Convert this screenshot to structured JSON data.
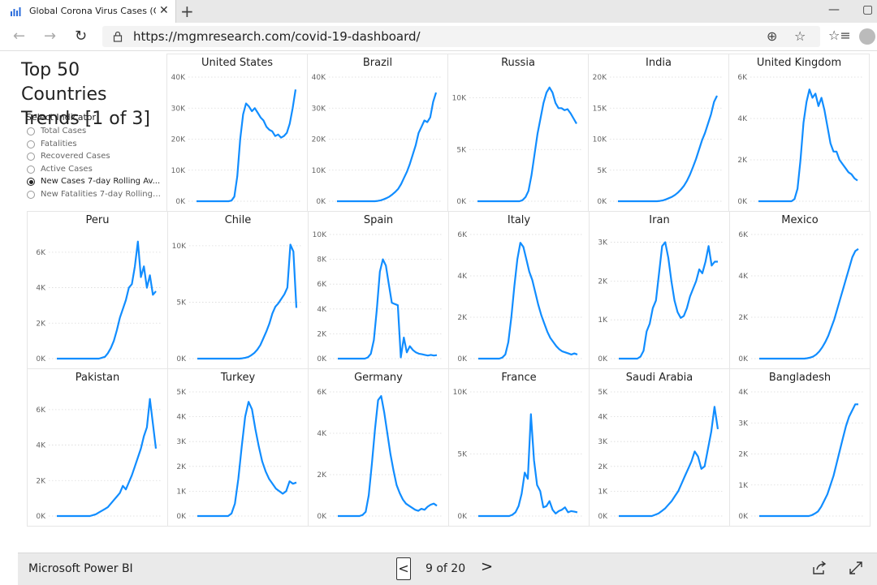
{
  "browser": {
    "tab_title": "Global Corona Virus Cases (Covid",
    "tab_close": "✕",
    "new_tab": "+",
    "url": "https://mgmresearch.com/covid-19-dashboard/",
    "nav_back_icon": "←",
    "nav_forward_icon": "→",
    "refresh_icon": "↻",
    "zoom_icon": "⊕",
    "favorite_icon": "☆",
    "favorites_bar_icon": "☆≡",
    "minimize_icon": "—",
    "maximize_icon": "▢"
  },
  "report": {
    "title": "Top 50 Countries Trends [1 of 3]",
    "slicer": {
      "title": "Select Indicator",
      "items": [
        {
          "label": "Total Cases",
          "selected": false
        },
        {
          "label": "Fatalities",
          "selected": false
        },
        {
          "label": "Recovered Cases",
          "selected": false
        },
        {
          "label": "Active Cases",
          "selected": false
        },
        {
          "label": "New Cases 7-day Rolling Av...",
          "selected": true
        },
        {
          "label": "New Fatalities 7-day Rolling ...",
          "selected": false
        }
      ]
    },
    "accent_color": "#118DFF"
  },
  "footer": {
    "brand": "Microsoft Power BI",
    "prev": "<",
    "page_text": "9 of 20",
    "next": ">"
  },
  "chart_data": [
    {
      "type": "line",
      "title": "United States",
      "ylim": [
        0,
        40000
      ],
      "yticks": [
        0,
        10000,
        20000,
        30000,
        40000
      ],
      "ytick_labels": [
        "0K",
        "10K",
        "20K",
        "30K",
        "40K"
      ],
      "values": [
        0,
        0,
        0,
        0,
        0,
        0,
        0,
        0,
        0,
        0,
        0,
        0,
        200,
        1500,
        8000,
        20000,
        28000,
        31500,
        30500,
        29000,
        30000,
        28500,
        27000,
        26000,
        24000,
        23000,
        22500,
        21000,
        21500,
        20500,
        21000,
        22000,
        25000,
        30000,
        36000
      ]
    },
    {
      "type": "line",
      "title": "Brazil",
      "ylim": [
        0,
        40000
      ],
      "yticks": [
        0,
        10000,
        20000,
        30000,
        40000
      ],
      "ytick_labels": [
        "0K",
        "10K",
        "20K",
        "30K",
        "40K"
      ],
      "values": [
        0,
        0,
        0,
        0,
        0,
        0,
        0,
        0,
        0,
        0,
        0,
        0,
        0,
        0,
        100,
        300,
        600,
        1000,
        1500,
        2200,
        3000,
        4000,
        5500,
        7500,
        9500,
        12000,
        15000,
        18000,
        22000,
        24000,
        26000,
        25500,
        27000,
        32000,
        35000
      ]
    },
    {
      "type": "line",
      "title": "Russia",
      "ylim": [
        0,
        12000
      ],
      "yticks": [
        0,
        5000,
        10000
      ],
      "ytick_labels": [
        "0K",
        "5K",
        "10K"
      ],
      "values": [
        0,
        0,
        0,
        0,
        0,
        0,
        0,
        0,
        0,
        0,
        0,
        0,
        0,
        0,
        0,
        100,
        400,
        1000,
        2500,
        4500,
        6500,
        8000,
        9500,
        10500,
        11000,
        10500,
        9500,
        9000,
        9000,
        8800,
        8900,
        8500,
        8000,
        7500
      ]
    },
    {
      "type": "line",
      "title": "India",
      "ylim": [
        0,
        20000
      ],
      "yticks": [
        0,
        5000,
        10000,
        15000,
        20000
      ],
      "ytick_labels": [
        "0K",
        "5K",
        "10K",
        "15K",
        "20K"
      ],
      "values": [
        0,
        0,
        0,
        0,
        0,
        0,
        0,
        0,
        0,
        0,
        0,
        0,
        0,
        0,
        50,
        150,
        300,
        500,
        700,
        1000,
        1400,
        1900,
        2500,
        3300,
        4300,
        5500,
        6800,
        8300,
        9800,
        11000,
        12500,
        14000,
        16000,
        17000
      ]
    },
    {
      "type": "line",
      "title": "United Kingdom",
      "ylim": [
        0,
        6000
      ],
      "yticks": [
        0,
        2000,
        4000,
        6000
      ],
      "ytick_labels": [
        "0K",
        "2K",
        "4K",
        "6K"
      ],
      "values": [
        0,
        0,
        0,
        0,
        0,
        0,
        0,
        0,
        0,
        0,
        0,
        0,
        100,
        600,
        2000,
        3800,
        4800,
        5400,
        5000,
        5200,
        4600,
        5000,
        4400,
        3600,
        2800,
        2400,
        2400,
        2000,
        1800,
        1600,
        1400,
        1300,
        1100,
        1000
      ]
    },
    {
      "type": "line",
      "title": "Peru",
      "ylim": [
        0,
        7000
      ],
      "yticks": [
        0,
        2000,
        4000,
        6000
      ],
      "ytick_labels": [
        "0K",
        "2K",
        "4K",
        "6K"
      ],
      "values": [
        0,
        0,
        0,
        0,
        0,
        0,
        0,
        0,
        0,
        0,
        0,
        0,
        0,
        0,
        0,
        50,
        100,
        300,
        600,
        1000,
        1600,
        2300,
        2800,
        3300,
        4000,
        4200,
        5200,
        6600,
        4600,
        5200,
        4000,
        4700,
        3600,
        3800
      ]
    },
    {
      "type": "line",
      "title": "Chile",
      "ylim": [
        0,
        11000
      ],
      "yticks": [
        0,
        5000,
        10000
      ],
      "ytick_labels": [
        "0K",
        "5K",
        "10K"
      ],
      "values": [
        0,
        0,
        0,
        0,
        0,
        0,
        0,
        0,
        0,
        0,
        0,
        0,
        0,
        0,
        0,
        30,
        80,
        150,
        300,
        500,
        800,
        1200,
        1800,
        2400,
        3100,
        4000,
        4600,
        4900,
        5300,
        5700,
        6300,
        10100,
        9500,
        4500
      ]
    },
    {
      "type": "line",
      "title": "Spain",
      "ylim": [
        0,
        10000
      ],
      "yticks": [
        0,
        2000,
        4000,
        6000,
        8000,
        10000
      ],
      "ytick_labels": [
        "0K",
        "2K",
        "4K",
        "6K",
        "8K",
        "10K"
      ],
      "values": [
        0,
        0,
        0,
        0,
        0,
        0,
        0,
        0,
        0,
        0,
        100,
        400,
        1500,
        4000,
        7000,
        8000,
        7500,
        6000,
        4500,
        4400,
        4300,
        100,
        1700,
        500,
        1000,
        700,
        500,
        400,
        350,
        300,
        250,
        300,
        250,
        280
      ]
    },
    {
      "type": "line",
      "title": "Italy",
      "ylim": [
        0,
        6000
      ],
      "yticks": [
        0,
        2000,
        4000,
        6000
      ],
      "ytick_labels": [
        "0K",
        "2K",
        "4K",
        "6K"
      ],
      "values": [
        0,
        0,
        0,
        0,
        0,
        0,
        0,
        0,
        50,
        200,
        800,
        2000,
        3500,
        4800,
        5600,
        5400,
        4800,
        4200,
        3800,
        3200,
        2600,
        2100,
        1700,
        1300,
        1000,
        800,
        600,
        450,
        350,
        300,
        250,
        200,
        250,
        200
      ]
    },
    {
      "type": "line",
      "title": "Iran",
      "ylim": [
        0,
        3200
      ],
      "yticks": [
        0,
        1000,
        2000,
        3000
      ],
      "ytick_labels": [
        "0K",
        "1K",
        "2K",
        "3K"
      ],
      "values": [
        0,
        0,
        0,
        0,
        0,
        0,
        0,
        50,
        200,
        700,
        900,
        1300,
        1500,
        2200,
        2900,
        3000,
        2600,
        2000,
        1500,
        1200,
        1050,
        1100,
        1300,
        1600,
        1800,
        2000,
        2300,
        2200,
        2500,
        2900,
        2400,
        2500,
        2500
      ]
    },
    {
      "type": "line",
      "title": "Mexico",
      "ylim": [
        0,
        6000
      ],
      "yticks": [
        0,
        2000,
        4000,
        6000
      ],
      "ytick_labels": [
        "0K",
        "2K",
        "4K",
        "6K"
      ],
      "values": [
        0,
        0,
        0,
        0,
        0,
        0,
        0,
        0,
        0,
        0,
        0,
        0,
        0,
        0,
        0,
        0,
        20,
        50,
        100,
        200,
        350,
        550,
        800,
        1100,
        1500,
        1900,
        2400,
        2900,
        3400,
        3900,
        4400,
        4900,
        5200,
        5300
      ]
    },
    {
      "type": "line",
      "title": "Pakistan",
      "ylim": [
        0,
        7000
      ],
      "yticks": [
        0,
        2000,
        4000,
        6000
      ],
      "ytick_labels": [
        "0K",
        "2K",
        "4K",
        "6K"
      ],
      "values": [
        0,
        0,
        0,
        0,
        0,
        0,
        0,
        0,
        0,
        0,
        0,
        0,
        50,
        100,
        200,
        300,
        400,
        500,
        700,
        900,
        1100,
        1300,
        1700,
        1500,
        1900,
        2300,
        2800,
        3300,
        3800,
        4500,
        5000,
        6600,
        5200,
        3800
      ]
    },
    {
      "type": "line",
      "title": "Turkey",
      "ylim": [
        0,
        5000
      ],
      "yticks": [
        0,
        1000,
        2000,
        3000,
        4000,
        5000
      ],
      "ytick_labels": [
        "0K",
        "1K",
        "2K",
        "3K",
        "4K",
        "5K"
      ],
      "values": [
        0,
        0,
        0,
        0,
        0,
        0,
        0,
        0,
        0,
        0,
        100,
        500,
        1500,
        2800,
        4000,
        4600,
        4300,
        3500,
        2800,
        2200,
        1800,
        1500,
        1300,
        1100,
        1000,
        900,
        1000,
        1400,
        1300,
        1350
      ]
    },
    {
      "type": "line",
      "title": "Germany",
      "ylim": [
        0,
        6000
      ],
      "yticks": [
        0,
        2000,
        4000,
        6000
      ],
      "ytick_labels": [
        "0K",
        "2K",
        "4K",
        "6K"
      ],
      "values": [
        0,
        0,
        0,
        0,
        0,
        0,
        0,
        0,
        50,
        200,
        1000,
        2500,
        4200,
        5600,
        5800,
        5000,
        4000,
        3000,
        2200,
        1500,
        1100,
        800,
        600,
        500,
        400,
        300,
        250,
        350,
        300,
        450,
        550,
        600,
        500
      ]
    },
    {
      "type": "line",
      "title": "France",
      "ylim": [
        0,
        10000
      ],
      "yticks": [
        0,
        5000,
        10000
      ],
      "ytick_labels": [
        "0K",
        "5K",
        "10K"
      ],
      "values": [
        0,
        0,
        0,
        0,
        0,
        0,
        0,
        0,
        0,
        0,
        0,
        100,
        300,
        800,
        1800,
        3500,
        3000,
        8200,
        4500,
        2500,
        2000,
        700,
        800,
        1200,
        500,
        200,
        400,
        500,
        700,
        300,
        400,
        350,
        300
      ]
    },
    {
      "type": "line",
      "title": "Saudi Arabia",
      "ylim": [
        0,
        5000
      ],
      "yticks": [
        0,
        1000,
        2000,
        3000,
        4000,
        5000
      ],
      "ytick_labels": [
        "0K",
        "1K",
        "2K",
        "3K",
        "4K",
        "5K"
      ],
      "values": [
        0,
        0,
        0,
        0,
        0,
        0,
        0,
        0,
        0,
        0,
        0,
        50,
        100,
        200,
        300,
        450,
        600,
        800,
        1000,
        1300,
        1600,
        1900,
        2200,
        2600,
        2400,
        1900,
        2000,
        2700,
        3400,
        4400,
        3500
      ]
    },
    {
      "type": "line",
      "title": "Bangladesh",
      "ylim": [
        0,
        4000
      ],
      "yticks": [
        0,
        1000,
        2000,
        3000,
        4000
      ],
      "ytick_labels": [
        "0K",
        "1K",
        "2K",
        "3K",
        "4K"
      ],
      "values": [
        0,
        0,
        0,
        0,
        0,
        0,
        0,
        0,
        0,
        0,
        0,
        0,
        0,
        0,
        0,
        0,
        0,
        30,
        80,
        150,
        300,
        500,
        700,
        1000,
        1300,
        1700,
        2100,
        2500,
        2900,
        3200,
        3400,
        3600,
        3600
      ]
    }
  ]
}
